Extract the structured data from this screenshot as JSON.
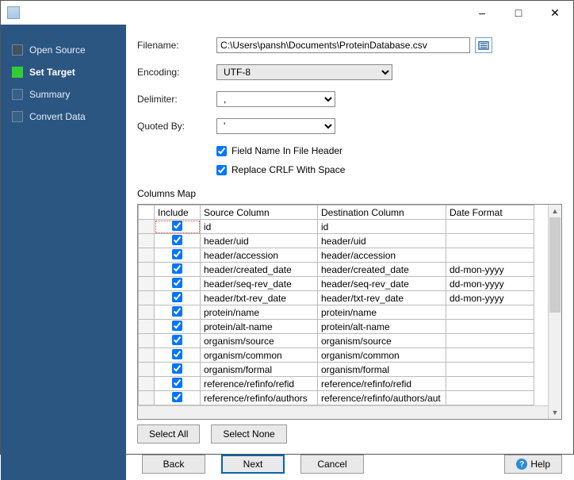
{
  "titlebar": {
    "title": ""
  },
  "sidebar": {
    "items": [
      {
        "label": "Open Source",
        "state": "done"
      },
      {
        "label": "Set Target",
        "state": "active"
      },
      {
        "label": "Summary",
        "state": "todo"
      },
      {
        "label": "Convert Data",
        "state": "todo"
      }
    ]
  },
  "form": {
    "filename_label": "Filename:",
    "filename_value": "C:\\Users\\pansh\\Documents\\ProteinDatabase.csv",
    "encoding_label": "Encoding:",
    "encoding_value": "UTF-8",
    "delimiter_label": "Delimiter:",
    "delimiter_value": ",",
    "quoted_label": "Quoted By:",
    "quoted_value": "'",
    "chk_header_label": "Field Name In File Header",
    "chk_header_checked": true,
    "chk_crlf_label": "Replace CRLF With Space",
    "chk_crlf_checked": true,
    "columns_map_label": "Columns Map"
  },
  "table": {
    "headers": {
      "include": "Include",
      "source": "Source Column",
      "dest": "Destination Column",
      "fmt": "Date Format"
    },
    "rows": [
      {
        "inc": true,
        "src": "id",
        "dst": "id",
        "fmt": ""
      },
      {
        "inc": true,
        "src": "header/uid",
        "dst": "header/uid",
        "fmt": ""
      },
      {
        "inc": true,
        "src": "header/accession",
        "dst": "header/accession",
        "fmt": ""
      },
      {
        "inc": true,
        "src": "header/created_date",
        "dst": "header/created_date",
        "fmt": "dd-mon-yyyy"
      },
      {
        "inc": true,
        "src": "header/seq-rev_date",
        "dst": "header/seq-rev_date",
        "fmt": "dd-mon-yyyy"
      },
      {
        "inc": true,
        "src": "header/txt-rev_date",
        "dst": "header/txt-rev_date",
        "fmt": "dd-mon-yyyy"
      },
      {
        "inc": true,
        "src": "protein/name",
        "dst": "protein/name",
        "fmt": ""
      },
      {
        "inc": true,
        "src": "protein/alt-name",
        "dst": "protein/alt-name",
        "fmt": ""
      },
      {
        "inc": true,
        "src": "organism/source",
        "dst": "organism/source",
        "fmt": ""
      },
      {
        "inc": true,
        "src": "organism/common",
        "dst": "organism/common",
        "fmt": ""
      },
      {
        "inc": true,
        "src": "organism/formal",
        "dst": "organism/formal",
        "fmt": ""
      },
      {
        "inc": true,
        "src": "reference/refinfo/refid",
        "dst": "reference/refinfo/refid",
        "fmt": ""
      },
      {
        "inc": true,
        "src": "reference/refinfo/authors",
        "dst": "reference/refinfo/authors/aut",
        "fmt": ""
      }
    ]
  },
  "buttons": {
    "select_all": "Select All",
    "select_none": "Select None",
    "back": "Back",
    "next": "Next",
    "cancel": "Cancel",
    "help": "Help"
  }
}
